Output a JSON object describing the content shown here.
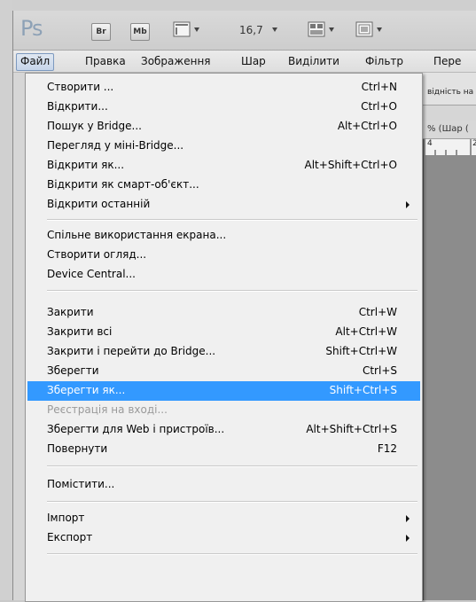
{
  "appbar": {
    "logo": "Ps",
    "bridge_btn": "Br",
    "minibridge_btn": "Mb",
    "zoom": "16,7"
  },
  "menubar": {
    "items": [
      "Файл",
      "Правка",
      "Зображення",
      "Шар",
      "Виділити",
      "Фільтр",
      "Пере"
    ]
  },
  "background": {
    "options_text": "відність на",
    "doc_tab": "% (Шар (",
    "ruler_marks": [
      "4",
      "2"
    ]
  },
  "file_menu": {
    "items": [
      {
        "label": "Створити ...",
        "shortcut": "Ctrl+N"
      },
      {
        "label": "Відкрити...",
        "shortcut": "Ctrl+O"
      },
      {
        "label": "Пошук у Bridge...",
        "shortcut": "Alt+Ctrl+O"
      },
      {
        "label": "Перегляд у міні-Bridge...",
        "shortcut": ""
      },
      {
        "label": "Відкрити як...",
        "shortcut": "Alt+Shift+Ctrl+O"
      },
      {
        "label": "Відкрити як смарт-об'єкт...",
        "shortcut": ""
      },
      {
        "label": "Відкрити останній",
        "shortcut": "",
        "submenu": true
      },
      {
        "label": "Спільне використання екрана...",
        "shortcut": ""
      },
      {
        "label": "Створити огляд...",
        "shortcut": ""
      },
      {
        "label": "Device Central...",
        "shortcut": ""
      },
      {
        "label": "Закрити",
        "shortcut": "Ctrl+W"
      },
      {
        "label": "Закрити всі",
        "shortcut": "Alt+Ctrl+W"
      },
      {
        "label": "Закрити і перейти до Bridge...",
        "shortcut": "Shift+Ctrl+W"
      },
      {
        "label": "Зберегти",
        "shortcut": "Ctrl+S"
      },
      {
        "label": "Зберегти як...",
        "shortcut": "Shift+Ctrl+S",
        "highlighted": true
      },
      {
        "label": "Реєстрація на вході...",
        "shortcut": "",
        "disabled": true
      },
      {
        "label": "Зберегти для Web і пристроїв...",
        "shortcut": "Alt+Shift+Ctrl+S"
      },
      {
        "label": "Повернути",
        "shortcut": "F12"
      },
      {
        "label": "Помістити...",
        "shortcut": ""
      },
      {
        "label": "Імпорт",
        "shortcut": "",
        "submenu": true
      },
      {
        "label": "Експорт",
        "shortcut": "",
        "submenu": true
      }
    ]
  }
}
